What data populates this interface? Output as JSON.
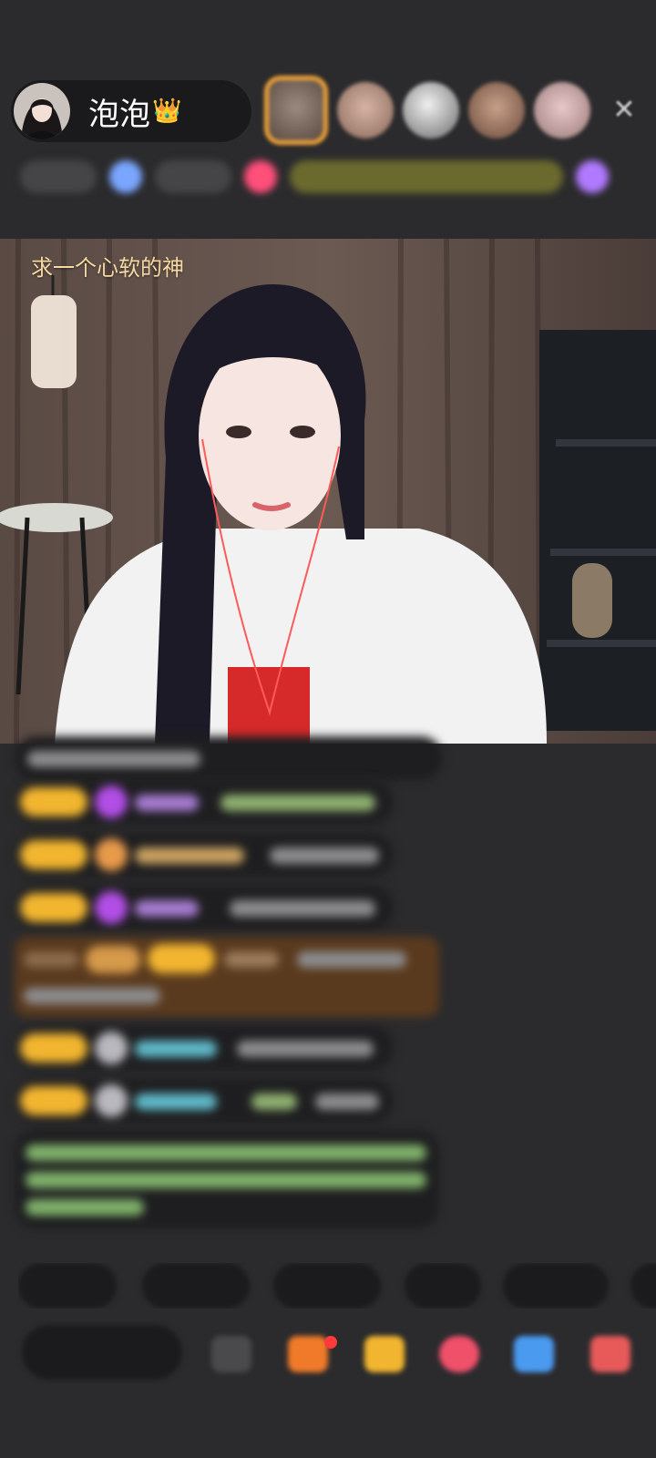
{
  "header": {
    "host_name": "泡泡",
    "host_badge_icon": "crown-icon",
    "close_icon": "close-icon"
  },
  "video": {
    "caption": "求一个心软的神"
  },
  "colors": {
    "background": "#2b2b2d",
    "level_badge": "#f2b52f",
    "caption": "#f6d9a2",
    "top_viewer_border": "#f0a23a",
    "notification_dot": "#ff3a3a"
  },
  "bottom_bar": {
    "icons": [
      "emoji-icon",
      "red-envelope-icon",
      "gift-box-icon",
      "chat-bubble-icon",
      "game-controller-icon",
      "more-apps-icon"
    ]
  }
}
